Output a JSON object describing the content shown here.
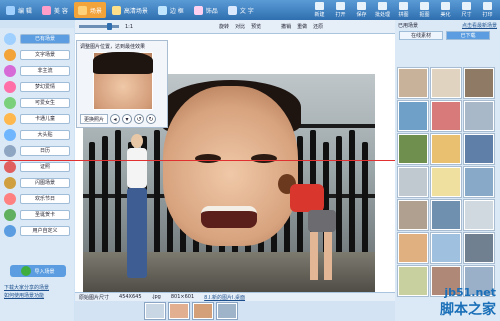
{
  "topbar": {
    "tabs": [
      {
        "label": "编 辑",
        "color": "#9fd0ff",
        "active": false
      },
      {
        "label": "美 容",
        "color": "#ff9ec9",
        "active": false
      },
      {
        "label": "场景",
        "color": "#ffd27a",
        "active": true
      },
      {
        "label": "高清场景",
        "color": "#ffe08a",
        "active": false
      },
      {
        "label": "边 框",
        "color": "#c0e6ff",
        "active": false
      },
      {
        "label": "饰品",
        "color": "#ffd0f0",
        "active": false
      },
      {
        "label": "文 字",
        "color": "#dbe9ff",
        "active": false
      }
    ],
    "right_tools": [
      "新建",
      "打开",
      "保存",
      "批处理",
      "拼图",
      "抠图",
      "美化",
      "尺寸",
      "打印"
    ]
  },
  "toolbar": {
    "zoom_label": "1:1",
    "rotate": "旋转",
    "flip": "对比",
    "preview": "预览",
    "undo": "撤销",
    "redo": "重做",
    "restore": "还原"
  },
  "sidebar": {
    "items": [
      {
        "label": "已有场景",
        "color": "#9fd0ff",
        "active": true
      },
      {
        "label": "文字场景",
        "color": "#f2a33a",
        "active": false
      },
      {
        "label": "非主流",
        "color": "#d66ad6",
        "active": false
      },
      {
        "label": "梦幻爱情",
        "color": "#ff6fa8",
        "active": false
      },
      {
        "label": "可爱女生",
        "color": "#7bd07b",
        "active": false
      },
      {
        "label": "卡通儿童",
        "color": "#ffb84d",
        "active": false
      },
      {
        "label": "大头贴",
        "color": "#6fb6ff",
        "active": false
      },
      {
        "label": "日历",
        "color": "#8fa6c2",
        "active": false
      },
      {
        "label": "证照",
        "color": "#e06060",
        "active": false
      },
      {
        "label": "闪图场景",
        "color": "#d0a040",
        "active": false
      },
      {
        "label": "欢乐节日",
        "color": "#ff8080",
        "active": false
      },
      {
        "label": "圣诞贺卡",
        "color": "#60b060",
        "active": false
      },
      {
        "label": "用户自定义",
        "color": "#5b9de0",
        "active": false
      }
    ],
    "import_button": "导入场景",
    "link1": "下载大家分享的场景",
    "link2": "如何使用场景功能"
  },
  "popup": {
    "title": "调整图片位置，达到最佳效果",
    "change_button": "更换照片"
  },
  "rightpanel": {
    "title": "已用场景",
    "link": "点击看最新场景",
    "tabs": [
      "在线素材",
      "已下载"
    ]
  },
  "statusbar": {
    "label": "原始图片尺寸",
    "size": "454X645",
    "format": ".jpg",
    "dims": "801×601",
    "link": "8.Ⅰ.新的图片Ⅰ.桌面"
  },
  "watermark": {
    "line1": "jb51.net",
    "line2": "脚本之家"
  },
  "colors": {
    "accent": "#5b9de0",
    "active_tab": "#f2a33a",
    "red_guide": "#e03030"
  }
}
